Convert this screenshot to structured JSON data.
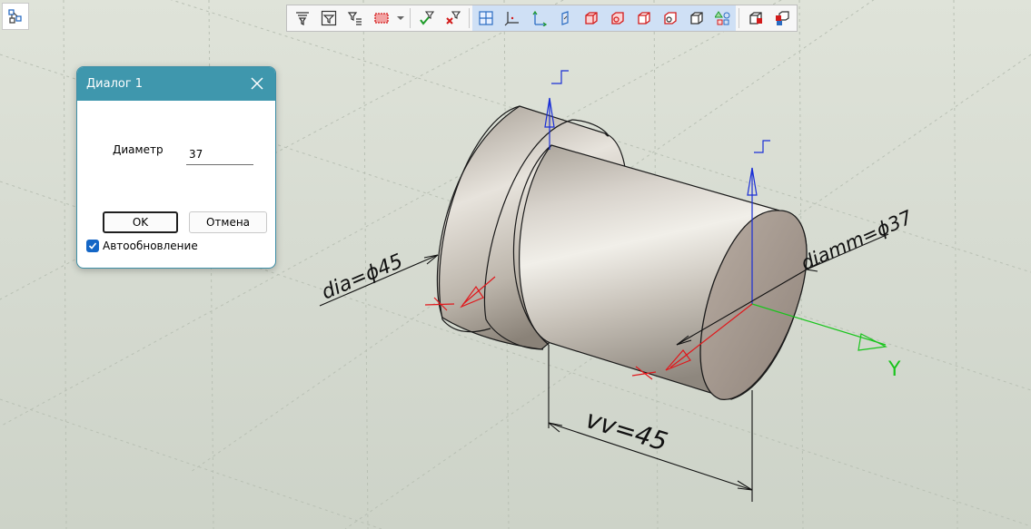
{
  "dialog": {
    "title": "Диалог 1",
    "diameter_label": "Диаметр",
    "diameter_value": "37",
    "ok_label": "OK",
    "cancel_label": "Отмена",
    "auto_update_label": "Автообновление",
    "auto_update_checked": true
  },
  "model": {
    "dim_dia": "dia=ϕ45",
    "dim_diamm": "diamm=ϕ37",
    "dim_vv": "vv=45",
    "axis_y": "Y"
  },
  "colors": {
    "dialog_title_bg": "#3f97ad",
    "checkbox_blue": "#1466c6",
    "axis_blue": "#1a2fd6",
    "axis_red": "#e0181c",
    "axis_green": "#19c41c"
  },
  "toolbar": {
    "icons": [
      "filter-icon",
      "filter-window-icon",
      "filter-list-icon",
      "color-filter-icon",
      "dropdown-arrow-icon",
      "apply-filter-icon",
      "clear-filter-icon",
      "grid-icon",
      "coordinate-system-icon",
      "axis-icon",
      "plane-icon",
      "solid-red-icon",
      "solid-hole-icon",
      "solid-box-icon",
      "solid-ring-icon",
      "solid-cube-icon",
      "shapes-icon",
      "body-icon",
      "body-group-icon"
    ]
  }
}
